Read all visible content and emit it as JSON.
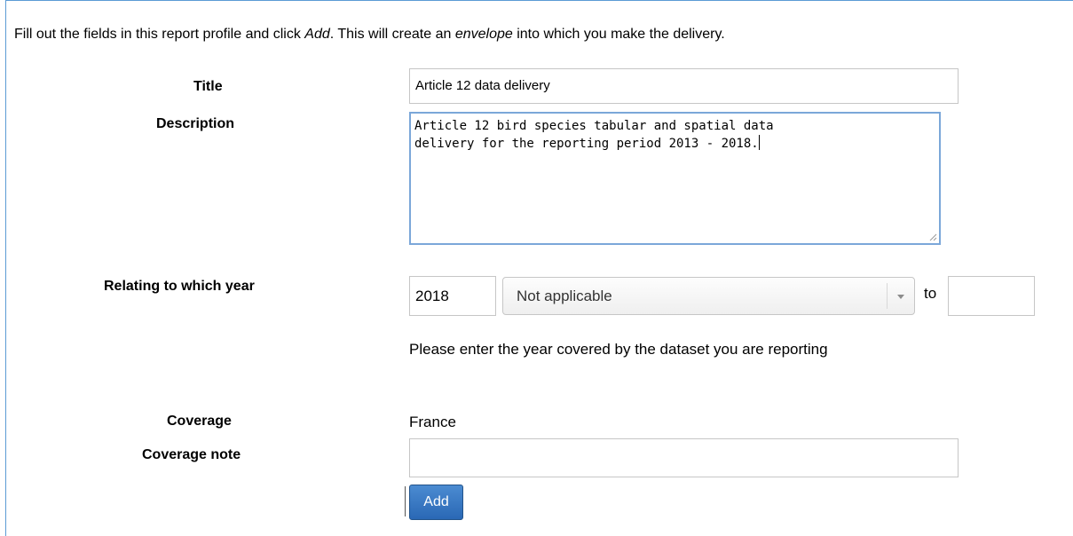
{
  "intro": {
    "part1": "Fill out the fields in this report profile and click ",
    "add_word": "Add",
    "part2": ". This will create an ",
    "envelope_word": "envelope",
    "part3": " into which you make the delivery."
  },
  "fields": {
    "title_label": "Title",
    "title_value": "Article 12 data delivery",
    "description_label": "Description",
    "description_value": "Article 12 bird species tabular and spatial data\ndelivery for the reporting period 2013 - 2018.",
    "year_label": "Relating to which year",
    "year_value": "2018",
    "year_option_selected": "Not applicable",
    "to_label": "to",
    "to_value": "",
    "year_help": "Please enter the year covered by the dataset you are reporting",
    "coverage_label": "Coverage",
    "coverage_value": "France",
    "coverage_note_label": "Coverage note",
    "coverage_note_value": ""
  },
  "actions": {
    "add_label": "Add"
  },
  "colors": {
    "frame_border": "#5b9bd5",
    "focus_border": "#7ba7d9",
    "button_bg": "#2a68b5"
  }
}
